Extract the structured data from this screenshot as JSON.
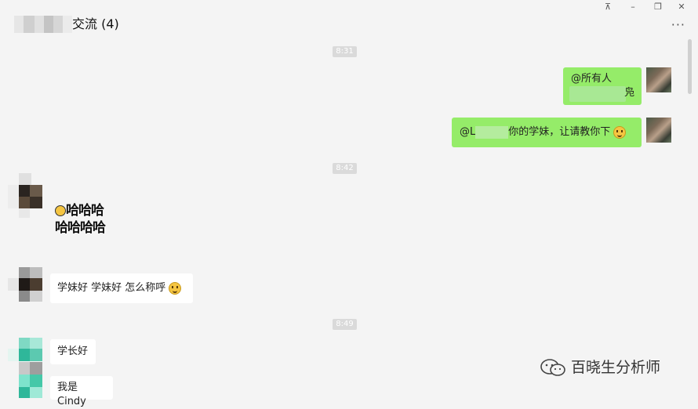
{
  "window": {
    "title_suffix": "交流 (4)",
    "controls": [
      "⊼",
      "–",
      "❐",
      "✕"
    ],
    "more": "···"
  },
  "timestamps": [
    "8:31",
    "8:42",
    "8:49"
  ],
  "messages": {
    "m1": {
      "text": "@所有人",
      "tail": "凫"
    },
    "m2": {
      "prefix": "@L",
      "text": "你的学妹，让请教你下"
    },
    "m3": {
      "line1": "哈哈哈",
      "line2": "哈哈哈哈"
    },
    "m4": {
      "text": "学妹好 学妹好 怎么称呼"
    },
    "m5": {
      "text": "学长好"
    },
    "m6": {
      "text": "我是Cindy"
    }
  },
  "watermark": {
    "text": "百晓生分析师"
  }
}
